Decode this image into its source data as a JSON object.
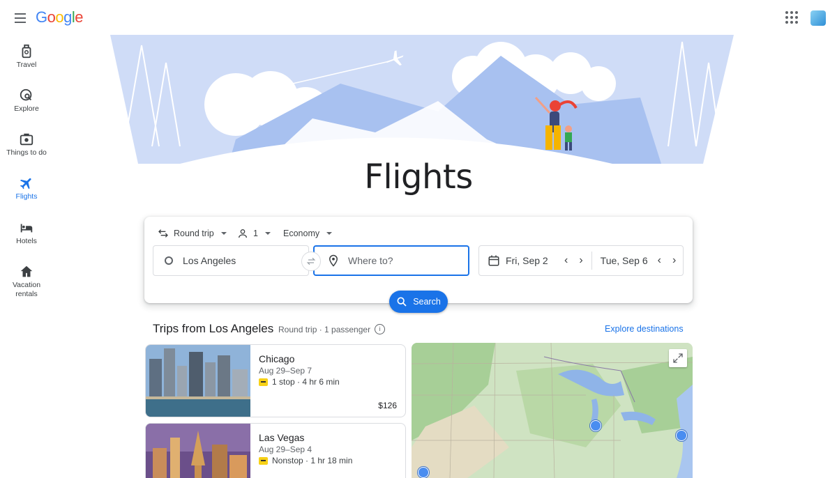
{
  "header": {
    "logo_text": "Google",
    "colors": [
      "#4285F4",
      "#EA4335",
      "#FBBC05",
      "#4285F4",
      "#34A853",
      "#EA4335"
    ]
  },
  "sidebar": {
    "items": [
      {
        "label": "Travel",
        "icon": "luggage-icon"
      },
      {
        "label": "Explore",
        "icon": "explore-icon"
      },
      {
        "label": "Things to do",
        "icon": "camera-icon"
      },
      {
        "label": "Flights",
        "icon": "plane-icon",
        "active": true
      },
      {
        "label": "Hotels",
        "icon": "bed-icon"
      },
      {
        "label": "Vacation rentals",
        "icon": "house-icon"
      }
    ]
  },
  "hero": {
    "title": "Flights"
  },
  "search": {
    "trip_type": "Round trip",
    "passengers": "1",
    "cabin": "Economy",
    "origin": "Los Angeles",
    "destination_placeholder": "Where to?",
    "depart_date": "Fri, Sep 2",
    "return_date": "Tue, Sep 6",
    "search_label": "Search"
  },
  "trips": {
    "heading": "Trips from Los Angeles",
    "subheading": "Round trip · 1 passenger",
    "explore_link": "Explore destinations",
    "cards": [
      {
        "city": "Chicago",
        "dates": "Aug 29–Sep 7",
        "info": "1 stop · 4 hr 6 min",
        "price": "$126"
      },
      {
        "city": "Las Vegas",
        "dates": "Aug 29–Sep 4",
        "info": "Nonstop · 1 hr 18 min",
        "price": ""
      }
    ]
  },
  "theme": {
    "accent": "#1a73e8",
    "text": "#202124",
    "muted": "#5f6368"
  }
}
